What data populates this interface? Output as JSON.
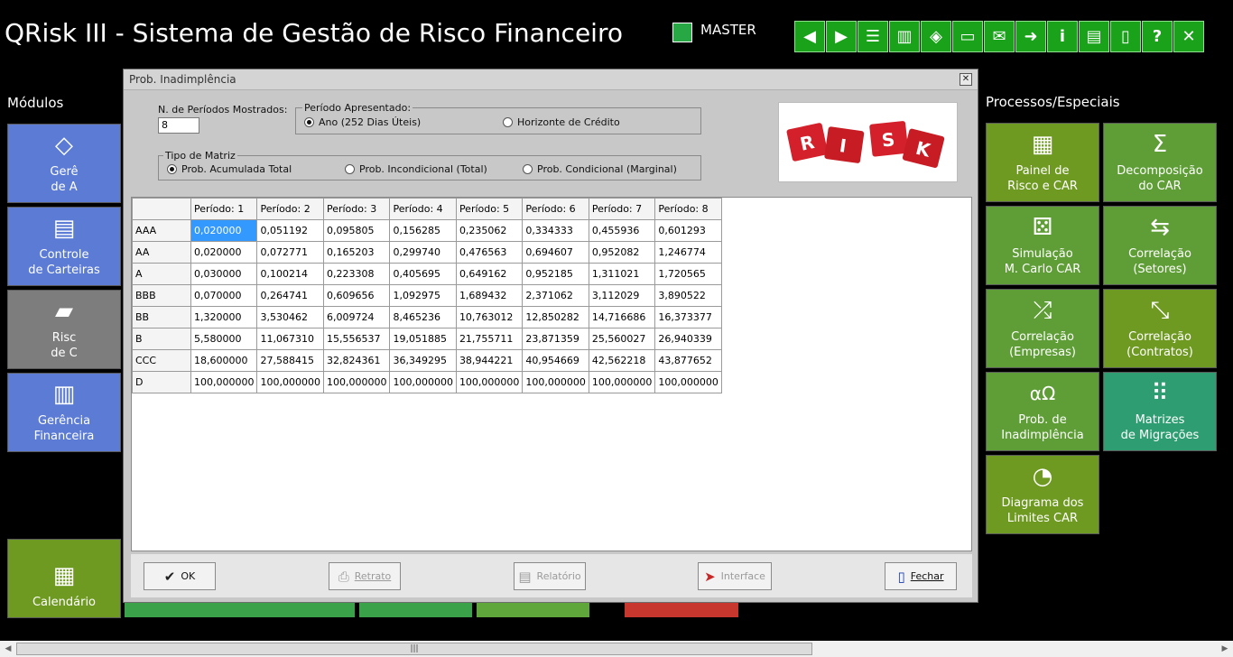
{
  "app": {
    "title": "QRisk III - Sistema de Gestão de Risco Financeiro",
    "user": "MASTER"
  },
  "toolbar": {
    "buttons": [
      {
        "name": "back",
        "glyph": "◀"
      },
      {
        "name": "forward",
        "glyph": "▶"
      },
      {
        "name": "traffic",
        "glyph": "☰"
      },
      {
        "name": "ladder",
        "glyph": "▥"
      },
      {
        "name": "bucket",
        "glyph": "◈"
      },
      {
        "name": "monitor",
        "glyph": "▭"
      },
      {
        "name": "mail",
        "glyph": "✉"
      },
      {
        "name": "send",
        "glyph": "➜"
      },
      {
        "name": "info",
        "glyph": "i"
      },
      {
        "name": "doc",
        "glyph": "▤"
      },
      {
        "name": "exit-door",
        "glyph": "▯"
      },
      {
        "name": "help",
        "glyph": "?"
      },
      {
        "name": "close",
        "glyph": "✕"
      }
    ]
  },
  "left": {
    "heading": "Módulos",
    "tiles": [
      {
        "l1": "Gerê",
        "l2": "de A",
        "icon": "◇"
      },
      {
        "l1": "Controle",
        "l2": "de Carteiras",
        "icon": "▤"
      },
      {
        "l1": "Risc",
        "l2": "de  C",
        "icon": "▰"
      },
      {
        "l1": "Gerência",
        "l2": "Financeira",
        "icon": "▥"
      },
      {
        "l1": "Calendário",
        "l2": "",
        "icon": "▦"
      }
    ]
  },
  "right": {
    "heading": "Processos/Especiais",
    "tiles": [
      {
        "l1": "Painel de",
        "l2": "Risco e CAR",
        "icon": "▦"
      },
      {
        "l1": "Decomposição",
        "l2": "do CAR",
        "icon": "Σ"
      },
      {
        "l1": "Simulação",
        "l2": "M. Carlo CAR",
        "icon": "⚄"
      },
      {
        "l1": "Correlação",
        "l2": "(Setores)",
        "icon": "⇆"
      },
      {
        "l1": "Correlação",
        "l2": "(Empresas)",
        "icon": "⤮"
      },
      {
        "l1": "Correlação",
        "l2": "(Contratos)",
        "icon": "⤡"
      },
      {
        "l1": "Prob. de",
        "l2": "Inadimplência",
        "icon": "αΩ"
      },
      {
        "l1": "Matrizes",
        "l2": "de Migrações",
        "icon": "⠿"
      },
      {
        "l1": "Diagrama dos",
        "l2": "Limites CAR",
        "icon": "◔"
      }
    ]
  },
  "dialog": {
    "title": "Prob. Inadimplência",
    "periods_label": "N. de Períodos Mostrados:",
    "periods_value": "8",
    "periodo_label": "Período Apresentado:",
    "periodo_opt1": "Ano (252 Dias Úteis)",
    "periodo_opt2": "Horizonte de Crédito",
    "tipo_label": "Tipo de Matriz",
    "tipo_opt1": "Prob. Acumulada Total",
    "tipo_opt2": "Prob. Incondicional (Total)",
    "tipo_opt3": "Prob. Condicional (Marginal)",
    "logo_letters": [
      "R",
      "I",
      "S",
      "K"
    ],
    "table": {
      "headers": [
        "Período: 1",
        "Período: 2",
        "Período: 3",
        "Período: 4",
        "Período: 5",
        "Período: 6",
        "Período: 7",
        "Período: 8"
      ],
      "rows": [
        {
          "rating": "AAA",
          "values": [
            "0,020000",
            "0,051192",
            "0,095805",
            "0,156285",
            "0,235062",
            "0,334333",
            "0,455936",
            "0,601293"
          ]
        },
        {
          "rating": "AA",
          "values": [
            "0,020000",
            "0,072771",
            "0,165203",
            "0,299740",
            "0,476563",
            "0,694607",
            "0,952082",
            "1,246774"
          ]
        },
        {
          "rating": "A",
          "values": [
            "0,030000",
            "0,100214",
            "0,223308",
            "0,405695",
            "0,649162",
            "0,952185",
            "1,311021",
            "1,720565"
          ]
        },
        {
          "rating": "BBB",
          "values": [
            "0,070000",
            "0,264741",
            "0,609656",
            "1,092975",
            "1,689432",
            "2,371062",
            "3,112029",
            "3,890522"
          ]
        },
        {
          "rating": "BB",
          "values": [
            "1,320000",
            "3,530462",
            "6,009724",
            "8,465236",
            "10,763012",
            "12,850282",
            "14,716686",
            "16,373377"
          ]
        },
        {
          "rating": "B",
          "values": [
            "5,580000",
            "11,067310",
            "15,556537",
            "19,051885",
            "21,755711",
            "23,871359",
            "25,560027",
            "26,940339"
          ]
        },
        {
          "rating": "CCC",
          "values": [
            "18,600000",
            "27,588415",
            "32,824361",
            "36,349295",
            "38,944221",
            "40,954669",
            "42,562218",
            "43,877652"
          ]
        },
        {
          "rating": "D",
          "values": [
            "100,000000",
            "100,000000",
            "100,000000",
            "100,000000",
            "100,000000",
            "100,000000",
            "100,000000",
            "100,000000"
          ]
        }
      ]
    },
    "buttons": {
      "ok": "OK",
      "retrato": "Retrato",
      "relatorio": "Relatório",
      "interface": "Interface",
      "fechar": "Fechar"
    }
  },
  "colors": {
    "green_button": "#1aa31a",
    "blue_tile": "#5b7bd5",
    "olive_tile": "#6f9a22",
    "selection": "#3399ff",
    "logo_red": "#d3202a"
  }
}
